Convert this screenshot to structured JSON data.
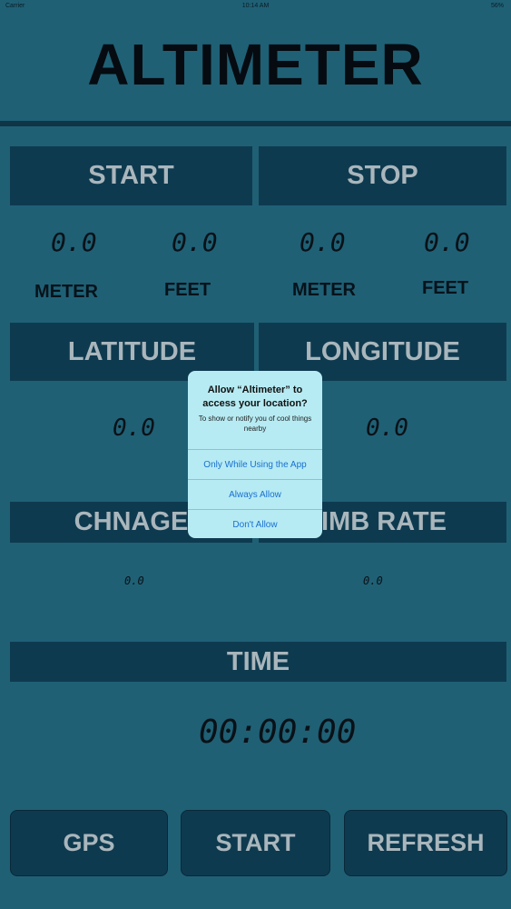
{
  "status_bar": {
    "carrier": "Carrier",
    "time": "10:14 AM",
    "battery": "56%"
  },
  "title": "ALTIMETER",
  "panels": {
    "start": "START",
    "stop": "STOP",
    "latitude": "LATITUDE",
    "longitude": "LONGITUDE",
    "change": "CHNAGE",
    "climb_rate": "CLIMB RATE",
    "time": "TIME"
  },
  "readings": {
    "start_meter": "0.0",
    "start_feet": "0.0",
    "stop_meter": "0.0",
    "stop_feet": "0.0",
    "latitude": "0.0",
    "longitude": "0.0",
    "change": "0.0",
    "climb_rate": "0.0",
    "time": "00:00:00"
  },
  "units": {
    "meter": "METER",
    "feet": "FEET"
  },
  "buttons": {
    "gps": "GPS",
    "start": "START",
    "refresh": "REFRESH"
  },
  "alert": {
    "title": "Allow “Altimeter” to access your location?",
    "message": "To show or notify you of cool things nearby",
    "options": [
      "Only While Using the App",
      "Always Allow",
      "Don't Allow"
    ]
  }
}
